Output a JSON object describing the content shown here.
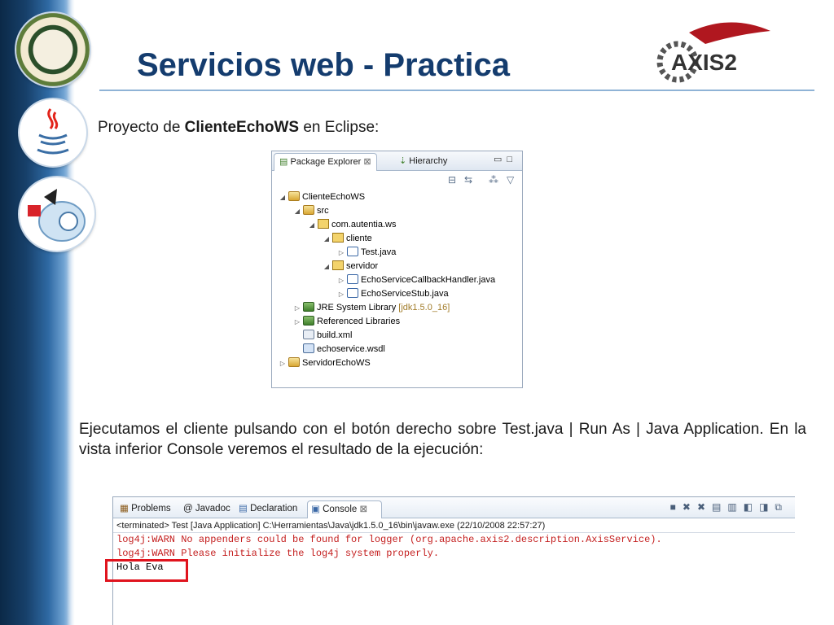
{
  "slide": {
    "title": "Servicios web - Practica",
    "subtitle_prefix": "Proyecto de ",
    "subtitle_bold": "ClienteEchoWS",
    "subtitle_suffix": " en Eclipse:",
    "paragraph": "Ejecutamos el cliente pulsando con el botón derecho sobre Test.java | Run As | Java Application. En la vista inferior Console veremos el resultado de la ejecución:",
    "axis_logo_text": "AXIS2"
  },
  "package_explorer": {
    "tab_label": "Package Explorer",
    "tab2_label": "Hierarchy",
    "tree": [
      {
        "label": "ClienteEchoWS",
        "icon": "project-icon",
        "twisty": "◢"
      },
      {
        "label": "src",
        "icon": "source-folder-icon",
        "twisty": "◢"
      },
      {
        "label": "com.autentia.ws",
        "icon": "package-icon",
        "twisty": "◢"
      },
      {
        "label": "cliente",
        "icon": "package-icon",
        "twisty": "◢"
      },
      {
        "label": "Test.java",
        "icon": "java-file-icon",
        "twisty": "▷"
      },
      {
        "label": "servidor",
        "icon": "package-icon",
        "twisty": "◢"
      },
      {
        "label": "EchoServiceCallbackHandler.java",
        "icon": "java-file-icon",
        "twisty": "▷"
      },
      {
        "label": "EchoServiceStub.java",
        "icon": "java-file-icon",
        "twisty": "▷"
      },
      {
        "label": "JRE System Library",
        "suffix": "[jdk1.5.0_16]",
        "icon": "library-icon",
        "twisty": "▷"
      },
      {
        "label": "Referenced Libraries",
        "icon": "library-icon",
        "twisty": "▷"
      },
      {
        "label": "build.xml",
        "icon": "xml-file-icon",
        "twisty": ""
      },
      {
        "label": "echoservice.wsdl",
        "icon": "wsdl-file-icon",
        "twisty": ""
      },
      {
        "label": "ServidorEchoWS",
        "icon": "project-icon",
        "twisty": "▷"
      }
    ]
  },
  "console": {
    "tabs": [
      "Problems",
      "Javadoc",
      "Declaration",
      "Console"
    ],
    "header": "<terminated> Test [Java Application] C:\\Herramientas\\Java\\jdk1.5.0_16\\bin\\javaw.exe (22/10/2008 22:57:27)",
    "lines": [
      {
        "text": "log4j:WARN No appenders could be found for logger (org.apache.axis2.description.AxisService).",
        "kind": "warn"
      },
      {
        "text": "log4j:WARN Please initialize the log4j system properly.",
        "kind": "warn"
      },
      {
        "text": "Hola Eva",
        "kind": "out"
      }
    ]
  },
  "colors": {
    "title": "#143c6e",
    "highlight": "#e0141e",
    "warn": "#c41f1f"
  }
}
